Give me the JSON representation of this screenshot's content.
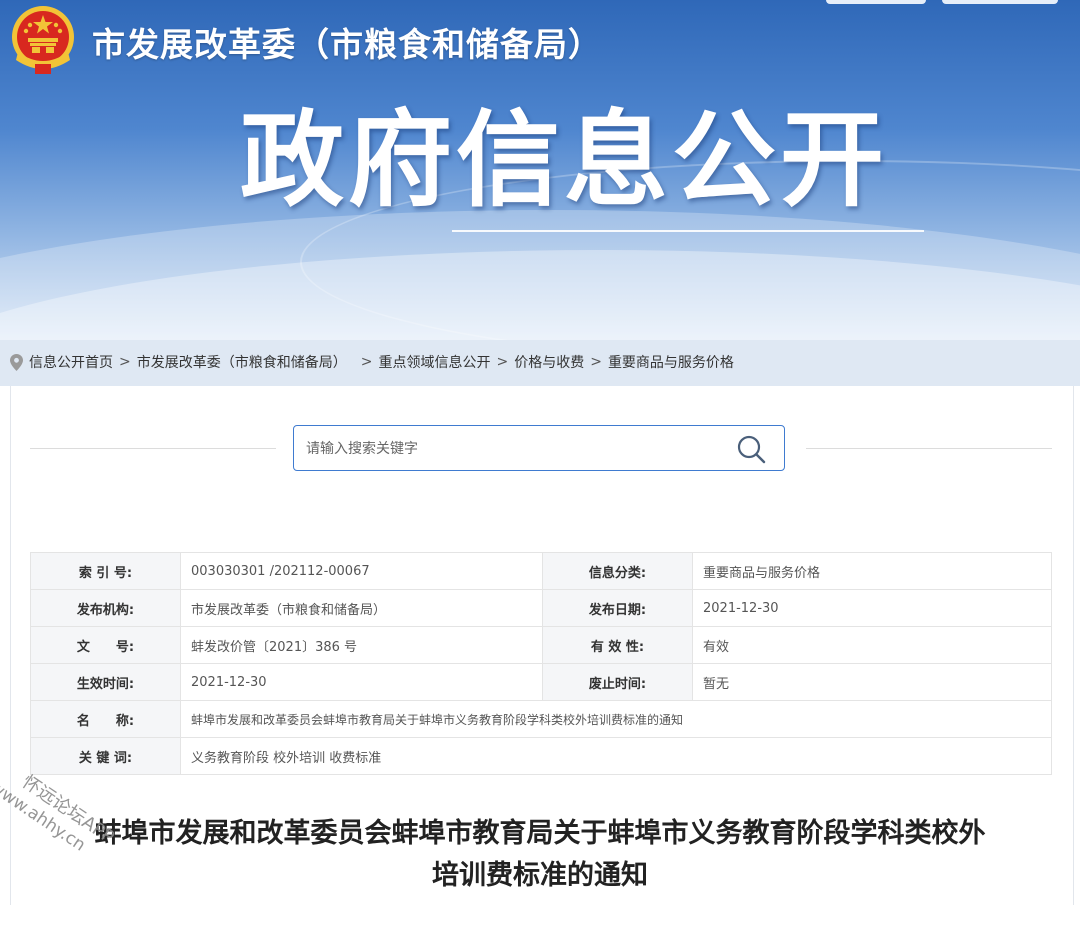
{
  "header": {
    "org_title": "市发展改革委（市粮食和储备局）",
    "banner_title": "政府信息公开"
  },
  "breadcrumb": {
    "items": [
      "信息公开首页",
      "市发展改革委（市粮食和储备局）",
      "重点领域信息公开",
      "价格与收费",
      "重要商品与服务价格"
    ],
    "separator": ">"
  },
  "search": {
    "placeholder": "请输入搜索关键字"
  },
  "info_table": {
    "index_label": "索 引 号:",
    "index_value": "003030301 /202112-00067",
    "category_label": "信息分类:",
    "category_value": "重要商品与服务价格",
    "publisher_label": "发布机构:",
    "publisher_value": "市发展改革委（市粮食和储备局）",
    "publish_date_label": "发布日期:",
    "publish_date_value": "2021-12-30",
    "doc_no_label": "文　　号:",
    "doc_no_value": "蚌发改价管〔2021〕386 号",
    "validity_label": "有 效 性:",
    "validity_value": "有效",
    "effective_label": "生效时间:",
    "effective_value": "2021-12-30",
    "expiry_label": "废止时间:",
    "expiry_value": "暂无",
    "name_label": "名　　称:",
    "name_value": "蚌埠市发展和改革委员会蚌埠市教育局关于蚌埠市义务教育阶段学科类校外培训费标准的通知",
    "keywords_label": "关 键 词:",
    "keywords_value": "义务教育阶段 校外培训 收费标准"
  },
  "article": {
    "title_line1": "蚌埠市发展和改革委员会蚌埠市教育局关于蚌埠市义务教育阶段学科类校外",
    "title_line2": "培训费标准的通知"
  },
  "watermark": {
    "line1": "怀远论坛APP",
    "line2": "www.ahhy.cn"
  },
  "colors": {
    "banner_top": "#2f68b8",
    "breadcrumb_bg": "#dfe8f3",
    "search_border": "#3f7bd0"
  }
}
